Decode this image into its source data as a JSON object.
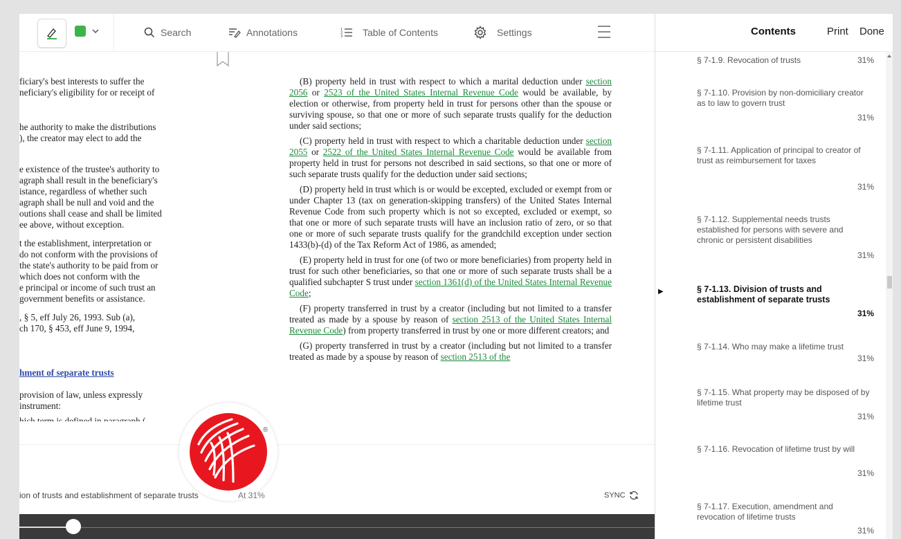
{
  "toolbar": {
    "search_label": "Search",
    "annotations_label": "Annotations",
    "toc_label": "Table of Contents",
    "settings_label": "Settings",
    "highlight_color": "#3bb54a"
  },
  "document": {
    "left_lines": [
      "ficiary's best interests to suffer the",
      "neficiary's eligibility for or receipt of",
      "he authority to make the distributions",
      "), the creator may elect to add the",
      "e existence of the trustee's authority to",
      "agraph shall result in the beneficiary's",
      "istance, regardless of whether such",
      "agraph shall be null and void and the",
      "outions shall cease and shall be limited",
      "ee above, without exception.",
      "t the establishment, interpretation or",
      "do not conform with the provisions of",
      "the state's authority to be paid from or",
      "which does not conform with the",
      "e principal or income of such trust an",
      "government benefits or assistance.",
      ", § 5, eff July 26, 1993. Sub (a),",
      "ch 170, § 453, eff June 9, 1994,",
      "hment of separate trusts",
      "provision of law, unless expressly",
      "instrument:",
      "hich term is defined in paragraph ("
    ],
    "right": {
      "b_1": "(B) property held in trust with respect to which a marital deduction under ",
      "b_link1": "section 2056",
      "b_2": " or ",
      "b_link2": "2523 of the United States Internal Revenue Code",
      "b_3": " would be available, by election or otherwise, from property held in trust for persons other than the spouse or surviving spouse, so that one or more of such separate trusts qualify for the deduction under said sections;",
      "c_1": "(C) property held in trust with respect to which a charitable deduction under ",
      "c_link1": "section 2055",
      "c_2": " or ",
      "c_link2": "2522 of the United States Internal Revenue Code",
      "c_3": " would be available from property held in trust for persons not described in said sections, so that one or more of such separate trusts qualify for the deduction under said sections;",
      "d": "(D) property held in trust which is or would be excepted, excluded or exempt from or under Chapter 13 (tax on generation-skipping transfers) of the United States Internal Revenue Code from such property which is not so excepted, excluded or exempt, so that one or more of such separate trusts will have an inclusion ratio of zero, or so that one or more of such separate trusts qualify for the grandchild exception under section 1433(b)-(d) of the Tax Reform Act of 1986, as amended;",
      "e_1": "(E) property held in trust for one (of two or more beneficiaries) from property held in trust for such other beneficiaries, so that one or more of such separate trusts shall be a qualified subchapter S trust under ",
      "e_link": "section 1361(d) of the United States Internal Revenue Code",
      "e_2": ";",
      "f_1": "(F) property transferred in trust by a creator (including but not limited to a transfer treated as made by a spouse by reason of ",
      "f_link": "section 2513 of the United States Internal Revenue Code",
      "f_2": ") from property transferred in trust by one or more different creators; and",
      "g_1": "(G) property transferred in trust by a creator (including but not limited to a transfer treated as made by a spouse by reason of ",
      "g_link": "section 2513 of the"
    },
    "registered_mark": "®"
  },
  "footer": {
    "chapter_title": "ion of trusts and establishment of separate trusts",
    "position": "At 31%",
    "sync_label": "SYNC",
    "progress": 0.085
  },
  "panel": {
    "title": "Contents",
    "print_label": "Print",
    "done_label": "Done",
    "items": [
      {
        "title": "§ 7-1.9. Revocation of trusts",
        "pct": "31%"
      },
      {
        "title": "§ 7-1.10. Provision by non-domiciliary creator as to law to govern trust",
        "pct": "31%"
      },
      {
        "title": "§ 7-1.11. Application of principal to creator of trust as reimbursement for taxes",
        "pct": "31%"
      },
      {
        "title": "§ 7-1.12. Supplemental needs trusts established for persons with severe and chronic or persistent disabilities",
        "pct": "31%"
      },
      {
        "title": "§ 7-1.13. Division of trusts and establishment of separate trusts",
        "pct": "31%"
      },
      {
        "title": "§ 7-1.14. Who may make a lifetime trust",
        "pct": "31%"
      },
      {
        "title": "§ 7-1.15. What property may be disposed of by lifetime trust",
        "pct": "31%"
      },
      {
        "title": "§ 7-1.16. Revocation of lifetime trust by will",
        "pct": "31%"
      },
      {
        "title": "§ 7-1.17. Execution, amendment and revocation of lifetime trusts",
        "pct": "31%"
      }
    ]
  }
}
